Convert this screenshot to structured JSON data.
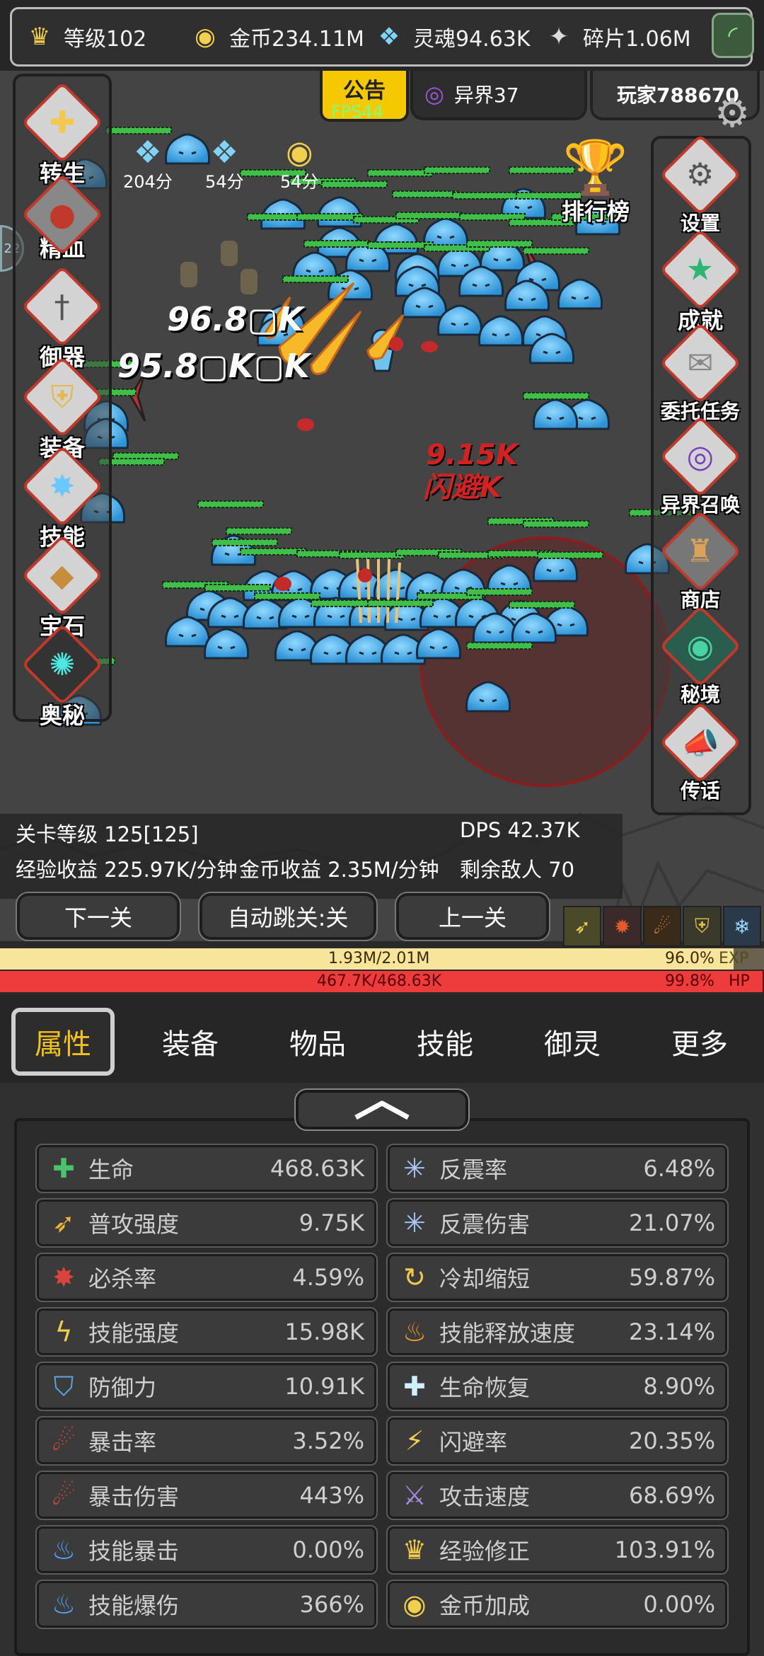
{
  "top_bar": {
    "level": "等级102",
    "gold": "金币234.11M",
    "soul": "灵魂94.63K",
    "shard": "碎片1.06M"
  },
  "notice": {
    "label": "公告",
    "fps": "FPS44"
  },
  "otherworld": {
    "label": "异界37"
  },
  "player": {
    "name": "玩家788670"
  },
  "left_menu": [
    "转生",
    "精血",
    "御器",
    "装备",
    "技能",
    "宝石",
    "奥秘"
  ],
  "right_menu": [
    "设置",
    "成就",
    "委托任务",
    "异界召唤",
    "商店",
    "秘境",
    "传话"
  ],
  "leaderboard": {
    "label": "排行榜"
  },
  "drops": [
    "204分",
    "54分",
    "54分"
  ],
  "side_edge_number": "22",
  "damage_texts": [
    "96.8▢K",
    "95.8▢K▢K",
    "9.15K",
    "闪避K"
  ],
  "stage": {
    "level": "关卡等级 125[125]",
    "dps": "DPS 42.37K",
    "exp_rate": "经验收益 225.97K/分钟",
    "gold_rate": "金币收益 2.35M/分钟",
    "enemies": "剩余敌人 70"
  },
  "buttons": {
    "next": "下一关",
    "auto_skip": "自动跳关:关",
    "prev": "上一关"
  },
  "exp": {
    "text": "1.93M/2.01M",
    "percent": "96.0%",
    "label": "EXP",
    "fraction": 0.96
  },
  "hp": {
    "text": "467.7K/468.63K",
    "percent": "99.8%",
    "label": "HP",
    "fraction": 0.998
  },
  "tabs": [
    "属性",
    "装备",
    "物品",
    "技能",
    "御灵",
    "更多"
  ],
  "stats_left": [
    {
      "name": "生命",
      "value": "468.63K",
      "icon": "plus-icon"
    },
    {
      "name": "普攻强度",
      "value": "9.75K",
      "icon": "feather-icon"
    },
    {
      "name": "必杀率",
      "value": "4.59%",
      "icon": "splash-icon"
    },
    {
      "name": "技能强度",
      "value": "15.98K",
      "icon": "lightning-icon"
    },
    {
      "name": "防御力",
      "value": "10.91K",
      "icon": "shield-icon"
    },
    {
      "name": "暴击率",
      "value": "3.52%",
      "icon": "claw-icon"
    },
    {
      "name": "暴击伤害",
      "value": "443%",
      "icon": "claw-icon"
    },
    {
      "name": "技能暴击",
      "value": "0.00%",
      "icon": "blue-flame-icon"
    },
    {
      "name": "技能爆伤",
      "value": "366%",
      "icon": "blue-flame-icon"
    }
  ],
  "stats_right": [
    {
      "name": "反震率",
      "value": "6.48%",
      "icon": "spark-icon"
    },
    {
      "name": "反震伤害",
      "value": "21.07%",
      "icon": "spark-icon"
    },
    {
      "name": "冷却缩短",
      "value": "59.87%",
      "icon": "swirl-icon"
    },
    {
      "name": "技能释放速度",
      "value": "23.14%",
      "icon": "fire-icon"
    },
    {
      "name": "生命恢复",
      "value": "8.90%",
      "icon": "plus-up-icon"
    },
    {
      "name": "闪避率",
      "value": "20.35%",
      "icon": "boot-icon"
    },
    {
      "name": "攻击速度",
      "value": "68.69%",
      "icon": "sword-icon"
    },
    {
      "name": "经验修正",
      "value": "103.91%",
      "icon": "crown-icon"
    },
    {
      "name": "金币加成",
      "value": "0.00%",
      "icon": "coin-icon"
    }
  ],
  "colors": {
    "accent": "#f4c21a",
    "exp": "#f6e59a",
    "hp": "#ee3b3b",
    "slime": "#3ba3df"
  }
}
